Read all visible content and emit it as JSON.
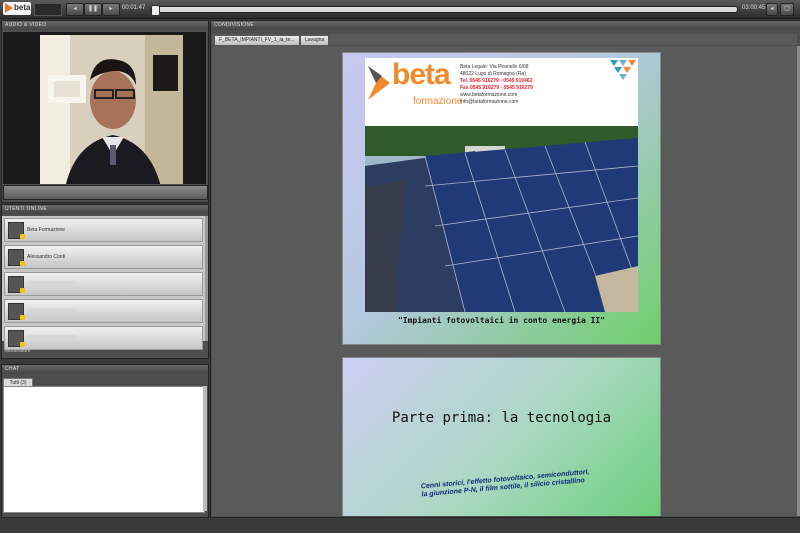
{
  "toolbar": {
    "logo_text": "beta",
    "time_elapsed": "00:01:47",
    "time_total": "03:00:45",
    "progress_fraction": 0.0
  },
  "panels": {
    "audio_video": "AUDIO & VIDEO",
    "users": "UTENTI ONLINE",
    "chat": "CHAT",
    "presentation": "CONDIVISIONE"
  },
  "users": {
    "items": [
      {
        "name": "Beta Formazione"
      },
      {
        "name": "Alessandro Conti"
      },
      {
        "name": ""
      },
      {
        "name": ""
      },
      {
        "name": ""
      }
    ],
    "footer": "Moderatore"
  },
  "chat": {
    "tab_label": "Tutti (3)"
  },
  "document": {
    "tab_label": "F_BETA_IMPIANTI_FV_1_la_te...",
    "page_button": "Lavagna"
  },
  "slide1": {
    "brand": "beta",
    "brand_sub": "formazione",
    "address_line1": "Beta Legale: Via Piranello 6/68",
    "address_line2": "48022 Lugo di Romagna (Ra)",
    "phone": "Tel. 0545 916279 - 0545 910462",
    "fax": "Fax 0545 916279 - 0545 916279",
    "web": "www.betaformazione.com",
    "email": "info@betaformazione.com",
    "caption": "\"Impianti fotovoltaici in conto energia II\""
  },
  "slide2": {
    "title": "Parte prima: la tecnologia",
    "subtitle": "Cenni storici, l'effetto fotovoltaico, semiconduttori, la giunzione P-N, il film sottile, il silicio cristallino"
  },
  "colors": {
    "brand_orange": "#f08a2c",
    "toolbar_dark": "#2c2c2c",
    "panel_bg": "#4e4e4e"
  }
}
